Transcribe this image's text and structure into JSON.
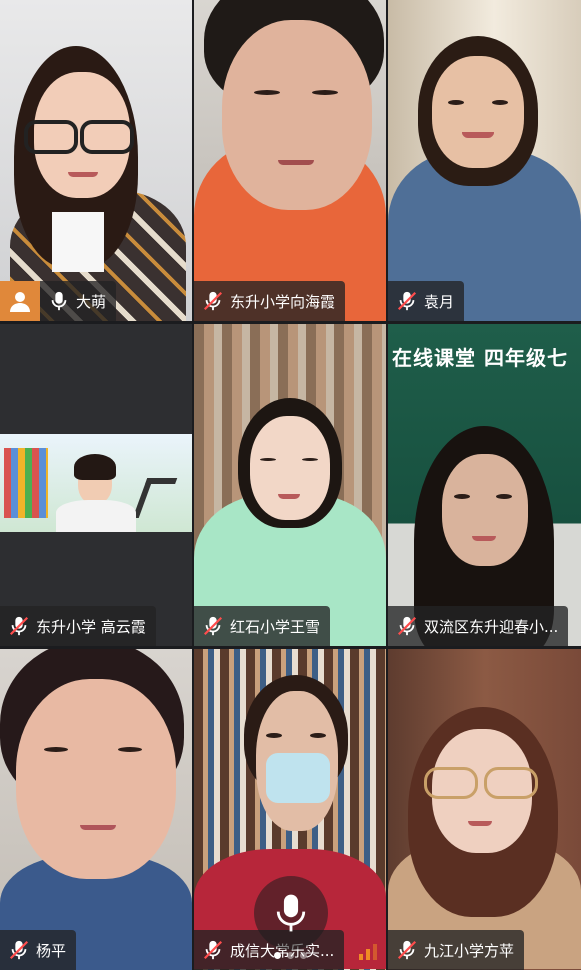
{
  "participants": [
    {
      "name": "大萌",
      "muted": false,
      "active": true
    },
    {
      "name": "东升小学向海霞",
      "muted": true
    },
    {
      "name": "袁月",
      "muted": true
    },
    {
      "name": "东升小学 高云霞",
      "muted": true
    },
    {
      "name": "红石小学王雪",
      "muted": true
    },
    {
      "name": "双流区东升迎春小...",
      "muted": true
    },
    {
      "name": "杨平",
      "muted": true
    },
    {
      "name": "成信大常乐实...",
      "muted": true
    },
    {
      "name": "九江小学方苹",
      "muted": true
    }
  ],
  "shared_screen": {
    "board_text": "在线课堂  四年级七"
  },
  "colors": {
    "active_border": "#3cbf6b",
    "avatar_badge": "#e0883a",
    "namebar_bg": "rgba(34,34,36,0.78)"
  },
  "icons": {
    "muted": "mic-muted-icon",
    "unmuted": "mic-icon",
    "avatar": "person-icon",
    "signal": "signal-icon"
  }
}
